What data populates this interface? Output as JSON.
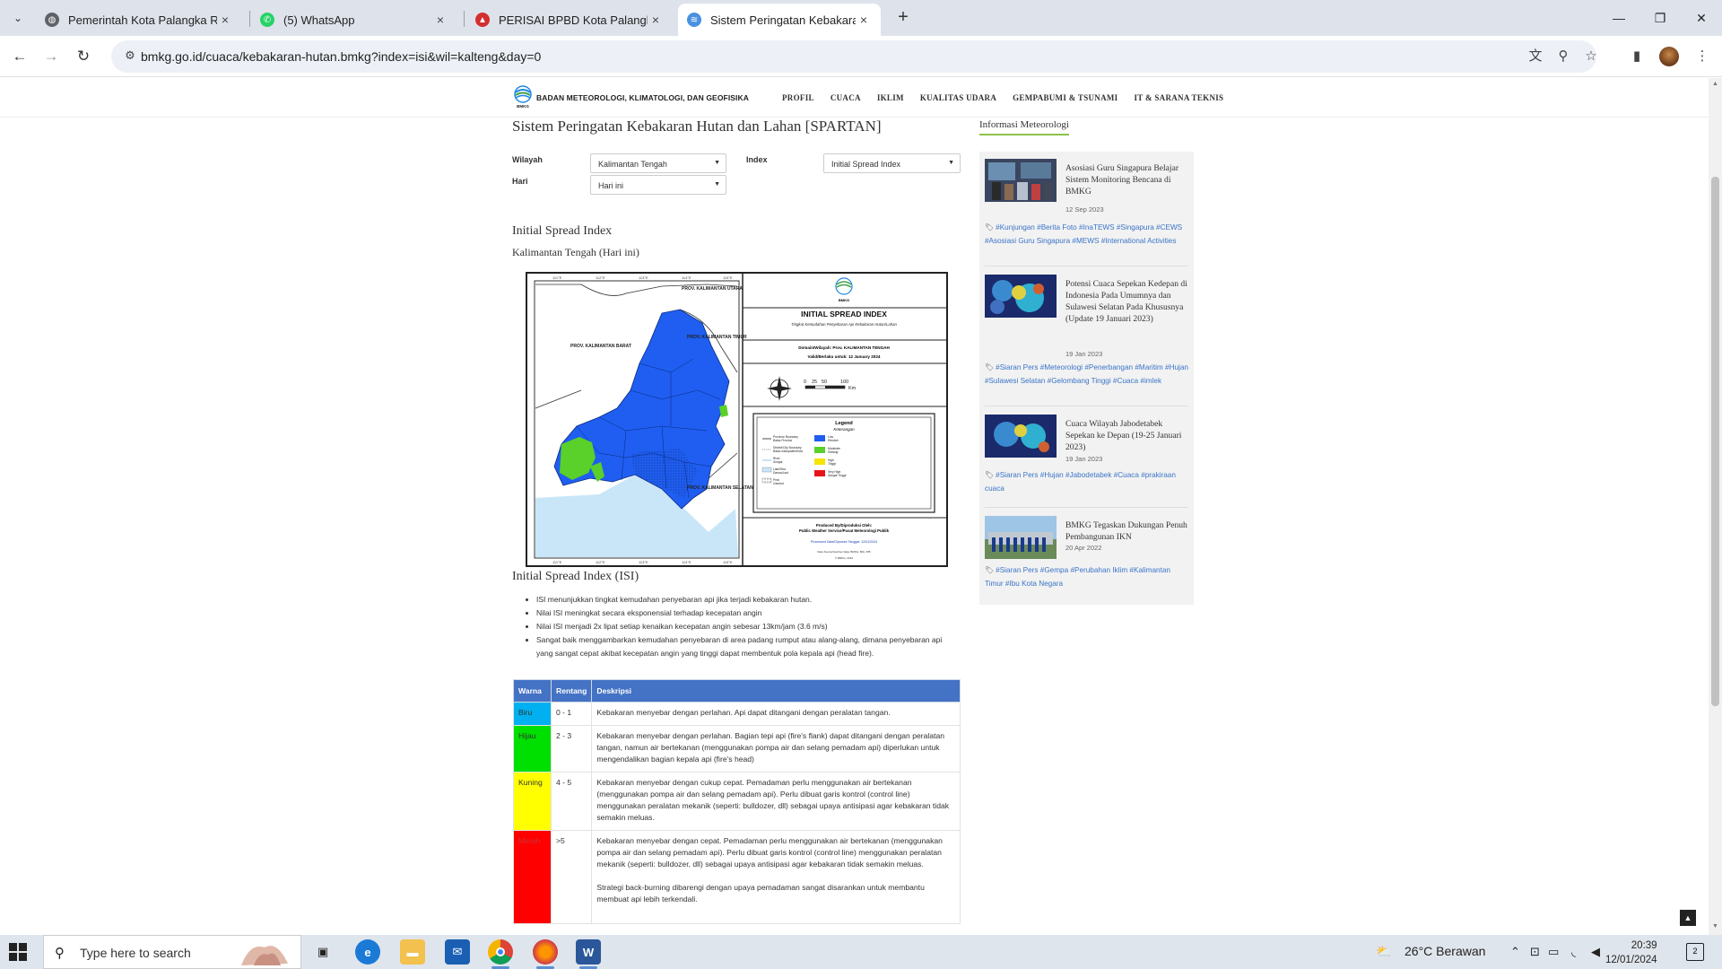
{
  "browser": {
    "tabs": [
      {
        "title": "Pemerintah Kota Palangka Raya",
        "fav_color": "#555555",
        "fav_glyph": "globe"
      },
      {
        "title": "(5) WhatsApp",
        "fav_color": "#25d366",
        "fav_glyph": "whatsapp"
      },
      {
        "title": "PERISAI BPBD Kota Palangka Raya",
        "fav_color": "#d32f2f",
        "fav_glyph": "shield"
      },
      {
        "title": "Sistem Peringatan Kebakaran H",
        "fav_color": "#4a90e2",
        "fav_glyph": "bmkg"
      }
    ],
    "close_glyph": "×",
    "new_tab_glyph": "+",
    "url": "bmkg.go.id/cuaca/kebakaran-hutan.bmkg?index=isi&wil=kalteng&day=0"
  },
  "site": {
    "brand": "BADAN METEOROLOGI, KLIMATOLOGI, DAN GEOFISIKA",
    "logo_text": "BMKG",
    "nav": [
      "PROFIL",
      "CUACA",
      "IKLIM",
      "KUALITAS UDARA",
      "GEMPABUMI & TSUNAMI",
      "IT & SARANA TEKNIS"
    ]
  },
  "main": {
    "title": "Sistem Peringatan Kebakaran Hutan dan Lahan [SPARTAN]",
    "filters": {
      "wilayah_label": "Wilayah",
      "wilayah_value": "Kalimantan Tengah",
      "hari_label": "Hari",
      "hari_value": "Hari ini",
      "index_label": "Index",
      "index_value": "Initial Spread Index"
    },
    "section_title": "Initial Spread Index",
    "section_subtitle": "Kalimantan Tengah (Hari ini)",
    "map": {
      "grid_top": [
        "111°E",
        "112°E",
        "113°E",
        "114°E",
        "115°E"
      ],
      "grid_bottom": [
        "111°E",
        "112°E",
        "113°E",
        "114°E",
        "115°E"
      ],
      "grid_left": [
        "1°S",
        "0°",
        "1°S",
        "2°S",
        "3°S",
        "4°S"
      ],
      "regions": {
        "kalbar": "PROV. KALIMANTAN BARAT",
        "kaltim": "PROV. KALIMANTAN TIMUR",
        "kaltara": "PROV. KALIMANTAN UTARA",
        "kalsel": "PROV. KALIMANTAN SELATAN"
      },
      "panel_logo": "BMKG",
      "panel_title": "INITIAL SPREAD INDEX",
      "panel_subtitle": "Tingkat Kemudahan Penyebaran Api Kebakaran Hutan/Lahan",
      "panel_domain": "Domain/Wilayah: Prov. KALIMANTAN TENGAH",
      "panel_valid": "Valid/Berlaku untuk: 12 January 2024",
      "scale_labels": [
        "0",
        "25",
        "50",
        "100"
      ],
      "scale_unit": "Km",
      "legend_title": "Legend",
      "legend_subtitle": "Keterangan",
      "legend_left": [
        "Province Boundary",
        "Batas Provinsi",
        "District/City Boundary",
        "Batas Kabupaten/Kota",
        "River",
        "Sungai",
        "Lake/Sea",
        "Danau/Laut",
        "Peat",
        "Gambut"
      ],
      "legend_right": [
        "Low",
        "Rendah",
        "Moderate",
        "Sedang",
        "High",
        "Tinggi",
        "Very High",
        "Sangat Tinggi"
      ],
      "produced_by": "Produced By/Diproduksi Oleh:",
      "produced_org": "Public Weather Service/Pusat Meteorologi Publik",
      "processed": "Processed Data/Diproses Tanggal: 12/01/2024",
      "source": "Data Source/Sumber Data: BMKG, BIG, IPB",
      "copyright": "© BMKG, 2024",
      "colors": {
        "low": "#1f5ef0",
        "moderate": "#5ad02a",
        "high": "#f5e400",
        "very_high": "#e8141a",
        "sea": "#c8e6f8"
      }
    },
    "isi_title": "Initial Spread Index (ISI)",
    "isi_points": [
      "ISI menunjukkan tingkat kemudahan penyebaran api jika terjadi kebakaran hutan.",
      "Nilai ISI meningkat secara eksponensial terhadap kecepatan angin",
      "Nilai ISI menjadi 2x lipat setiap kenaikan kecepatan angin sebesar 13km/jam (3.6 m/s)",
      "Sangat baik menggambarkan kemudahan penyebaran di area padang rumput atau alang-alang, dimana penyebaran api yang sangat cepat akibat kecepatan angin yang tinggi dapat membentuk pola kepala api (head fire)."
    ],
    "table": {
      "headers": [
        "Warna",
        "Rentang",
        "Deskripsi"
      ],
      "rows": [
        {
          "warna": "Biru",
          "rentang": "0 - 1",
          "color": "#00b0f0",
          "text_color": "#333333",
          "desc": "Kebakaran menyebar dengan perlahan. Api dapat ditangani dengan peralatan tangan.",
          "desc2": ""
        },
        {
          "warna": "Hijau",
          "rentang": "2 - 3",
          "color": "#00e000",
          "text_color": "#333333",
          "desc": "Kebakaran menyebar dengan perlahan. Bagian tepi api (fire's flank) dapat ditangani dengan peralatan tangan, namun air bertekanan (menggunakan pompa air dan selang pemadam api) diperlukan untuk mengendalikan bagian kepala api (fire's head)",
          "desc2": ""
        },
        {
          "warna": "Kuning",
          "rentang": "4 - 5",
          "color": "#ffff00",
          "text_color": "#333333",
          "desc": "Kebakaran menyebar dengan cukup cepat. Pemadaman perlu menggunakan air bertekanan (menggunakan pompa air dan selang pemadam api). Perlu dibuat garis kontrol (control line) menggunakan peralatan mekanik (seperti: bulldozer, dll) sebagai upaya antisipasi agar kebakaran tidak semakin meluas.",
          "desc2": ""
        },
        {
          "warna": "Merah",
          "rentang": ">5",
          "color": "#ff0000",
          "text_color": "#cc3333",
          "desc": "Kebakaran menyebar dengan cepat. Pemadaman perlu menggunakan air bertekanan (menggunakan pompa air dan selang pemadam api). Perlu dibuat garis kontrol (control line) menggunakan peralatan mekanik (seperti: bulldozer, dll) sebagai upaya antisipasi agar kebakaran tidak semakin meluas.",
          "desc2": "Strategi back-burning dibarengi dengan upaya pemadaman sangat disarankan untuk membantu membuat api lebih terkendali."
        }
      ]
    }
  },
  "sidebar": {
    "title": "Informasi Meteorologi",
    "tag_glyph": "🏷",
    "items": [
      {
        "title": "Asosiasi Guru Singapura Belajar Sistem Monitoring Bencana di BMKG",
        "date": "12 Sep 2023",
        "tags": "#Kunjungan #Berita Foto #InaTEWS #Singapura #CEWS #Asosiasi Guru Singapura #MEWS #International Activities",
        "thumb": "photo"
      },
      {
        "title": "Potensi Cuaca Sepekan Kedepan di Indonesia Pada Umumnya dan Sulawesi Selatan Pada Khususnya (Update 19 Januari 2023)",
        "date": "19 Jan 2023",
        "tags": "#Siaran Pers #Meteorologi #Penerbangan #Maritim #Hujan #Sulawesi Selatan #Gelombang Tinggi #Cuaca #imlek",
        "thumb": "satellite"
      },
      {
        "title": "Cuaca Wilayah Jabodetabek Sepekan ke Depan (19-25 Januari 2023)",
        "date": "19 Jan 2023",
        "tags": "#Siaran Pers #Hujan #Jabodetabek #Cuaca #prakiraan cuaca",
        "thumb": "satellite"
      },
      {
        "title": "BMKG Tegaskan Dukungan Penuh Pembangunan IKN",
        "date": "20 Apr 2022",
        "tags": "#Siaran Pers #Gempa #Perubahan Iklim #Kalimantan Timur #Ibu Kota Negara",
        "thumb": "group"
      }
    ]
  },
  "taskbar": {
    "search_placeholder": "Type here to search",
    "weather": "26°C  Berawan",
    "time": "20:39",
    "date": "12/01/2024",
    "notif_count": "2",
    "apps": [
      "task-view",
      "edge",
      "file-explorer",
      "mail",
      "chrome",
      "firefox",
      "word"
    ]
  }
}
